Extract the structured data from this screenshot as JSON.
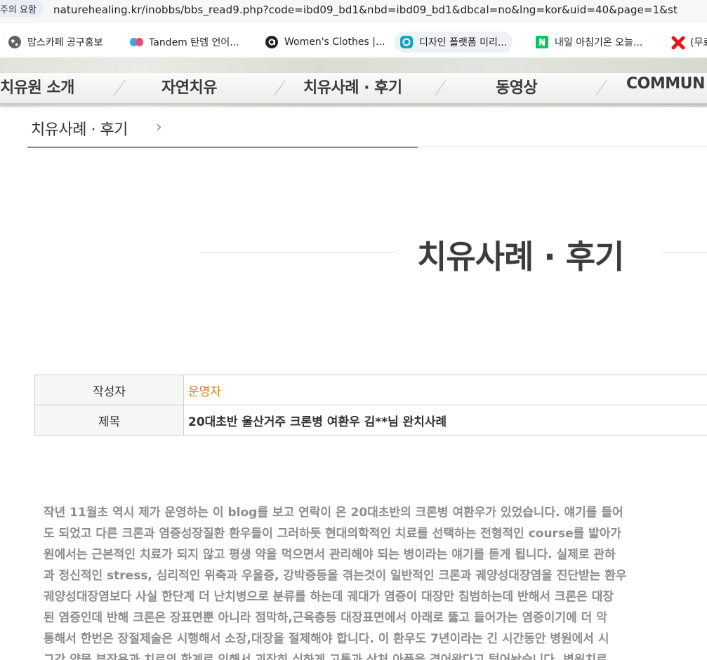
{
  "browser": {
    "tab_fragment": "주의 요함",
    "url": "naturehealing.kr/inobbs/bbs_read9.php?code=ibd09_bd1&nbd=ibd09_bd1&dbcal=no&lng=kor&uid=40&page=1&st"
  },
  "bookmarks": [
    {
      "label": "맘스카페 공구홍보",
      "icon": "globe-icon",
      "color": "#555555"
    },
    {
      "label": "Tandem 탄뎀 언어...",
      "icon": "tandem-icon",
      "color": "#e84d7a"
    },
    {
      "label": "Women's Clothes |...",
      "icon": "a-logo-icon",
      "color": "#222222"
    },
    {
      "label": "디자인 플랫폼 미리...",
      "icon": "miri-icon",
      "color": "#1aa3b8"
    },
    {
      "label": "내일 아침기온 오늘...",
      "icon": "naver-icon",
      "color": "#03c75a"
    },
    {
      "label": "(무료",
      "icon": "x-icon",
      "color": "#e8141b"
    }
  ],
  "nav": {
    "items": [
      "치유원 소개",
      "자연치유",
      "치유사례 · 후기",
      "동영상",
      "COMMUN"
    ]
  },
  "breadcrumb": {
    "label": "치유사례 · 후기",
    "arrow": "›"
  },
  "page": {
    "title": "치유사례 · 후기"
  },
  "post": {
    "writer_label": "작성자",
    "writer": "운영자",
    "subject_label": "제목",
    "subject": "20대초반 울산거주 크론병 여환우 김**님 완치사례"
  },
  "content": {
    "lines": [
      "작년 11월초 역시 제가 운영하는 이 blog를 보고 연락이 온 20대초반의 크론병 여환우가 있었습니다. 얘기를 들어",
      "도 되었고 다른 크론과 염증성장질환 환우들이 그러하듯 현대의학적인 치료를 선택하는 전형적인 course를 밟아가",
      "원에서는 근본적인 치료가 되지 않고 평생 약을 먹으면서 관리해야 되는 병이라는 얘기를 듣게 됩니다. 실제로 관하",
      "과 정신적인 stress, 심리적인 위축과 우울증, 강박증등을 겪는것이 일반적인 크론과 궤양성대장염을 진단받는 환우",
      "궤양성대장염보다 사실 한단계 더 난치병으로 분류를 하는데 궤대가 염증이 대장만 침범하는데 반해서 크론은 대장",
      "된 염증인데 반해 크론은 장표면뿐 아니라 점막하,근육층등 대장표면에서 아래로 뚫고 들어가는 염증이기에 더 악",
      "통해서 한번은 장절제술은 시행해서 소장,대장을 절제해야 합니다. 이 환우도 7년이라는 긴 시간동안 병원에서 시",
      "그간 약물 부작용과 치료의 한계로 인해서 괴장히 심하게 고통과 상처 아픔을 겪어왔다고 털어놨습니다. 병원치료"
    ]
  }
}
